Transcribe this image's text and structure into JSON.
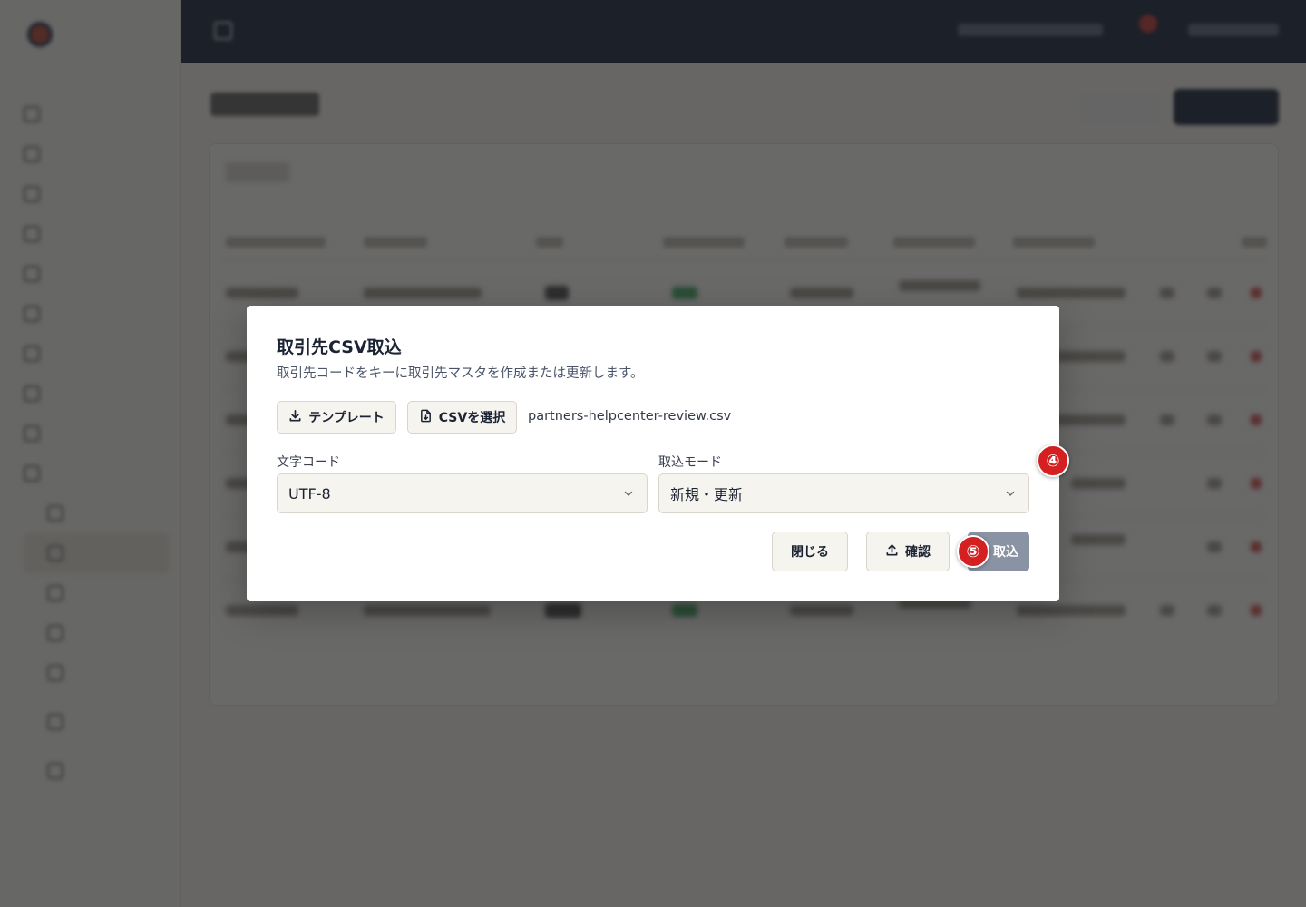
{
  "modal": {
    "title": "取引先CSV取込",
    "description": "取引先コードをキーに取引先マスタを作成または更新します。",
    "template_button": "テンプレート",
    "select_csv_button": "CSVを選択",
    "file_name": "partners-helpcenter-review.csv",
    "encoding_label": "文字コード",
    "encoding_value": "UTF-8",
    "mode_label": "取込モード",
    "mode_value": "新規・更新",
    "close_button": "閉じる",
    "confirm_button": "確認",
    "import_button": "取込"
  },
  "annotations": {
    "step4": "④",
    "step5": "⑤"
  },
  "colors": {
    "overlay": "#232323",
    "primary_disabled": "#8a93a4",
    "badge": "#d42020",
    "topbar": "#0f1a33"
  },
  "icons": [
    "download-icon",
    "file-csv-icon",
    "upload-icon",
    "chevron-down-icon"
  ]
}
